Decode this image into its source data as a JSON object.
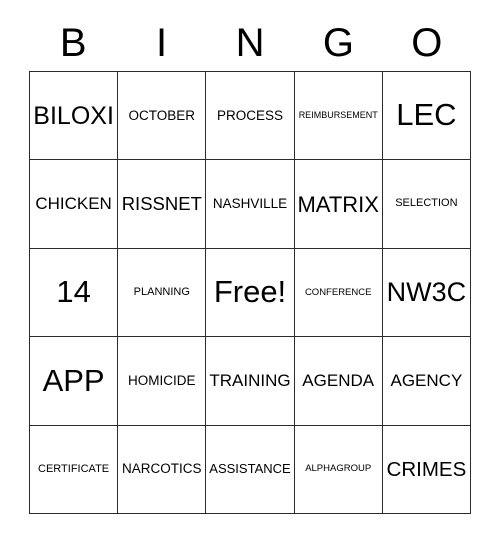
{
  "card": {
    "title": "BINGO",
    "header_letters": [
      "B",
      "I",
      "N",
      "G",
      "O"
    ],
    "free_space_label": "Free!",
    "colors": {
      "background": "#ffffff",
      "border": "#2b2b2b",
      "text": "#000000"
    },
    "grid": {
      "columns": 5,
      "rows": 5,
      "cells": [
        [
          {
            "label": "BILOXI",
            "size": "xl"
          },
          {
            "label": "OCTOBER",
            "size": "sm"
          },
          {
            "label": "PROCESS",
            "size": "sm"
          },
          {
            "label": "REIMBURSEMENT",
            "size": "xxs"
          },
          {
            "label": "LEC",
            "size": "xxl"
          }
        ],
        [
          {
            "label": "CHICKEN",
            "size": "md"
          },
          {
            "label": "RISSNET",
            "size": "lg"
          },
          {
            "label": "NASHVILLE",
            "size": "sm"
          },
          {
            "label": "MATRIX",
            "size": "lg"
          },
          {
            "label": "SELECTION",
            "size": "xs"
          }
        ],
        [
          {
            "label": "14",
            "size": "xxl"
          },
          {
            "label": "PLANNING",
            "size": "xs"
          },
          {
            "label": "Free!",
            "size": "xxl"
          },
          {
            "label": "CONFERENCE",
            "size": "xxs"
          },
          {
            "label": "NW3C",
            "size": "xl"
          }
        ],
        [
          {
            "label": "APP",
            "size": "xxl"
          },
          {
            "label": "HOMICIDE",
            "size": "sm"
          },
          {
            "label": "TRAINING",
            "size": "md"
          },
          {
            "label": "AGENDA",
            "size": "md"
          },
          {
            "label": "AGENCY",
            "size": "md"
          }
        ],
        [
          {
            "label": "CERTIFICATE",
            "size": "xs"
          },
          {
            "label": "NARCOTICS",
            "size": "sm"
          },
          {
            "label": "ASSISTANCE",
            "size": "sm"
          },
          {
            "label": "ALPHAGROUP",
            "size": "xxs"
          },
          {
            "label": "CRIMES",
            "size": "xl"
          }
        ]
      ]
    }
  }
}
